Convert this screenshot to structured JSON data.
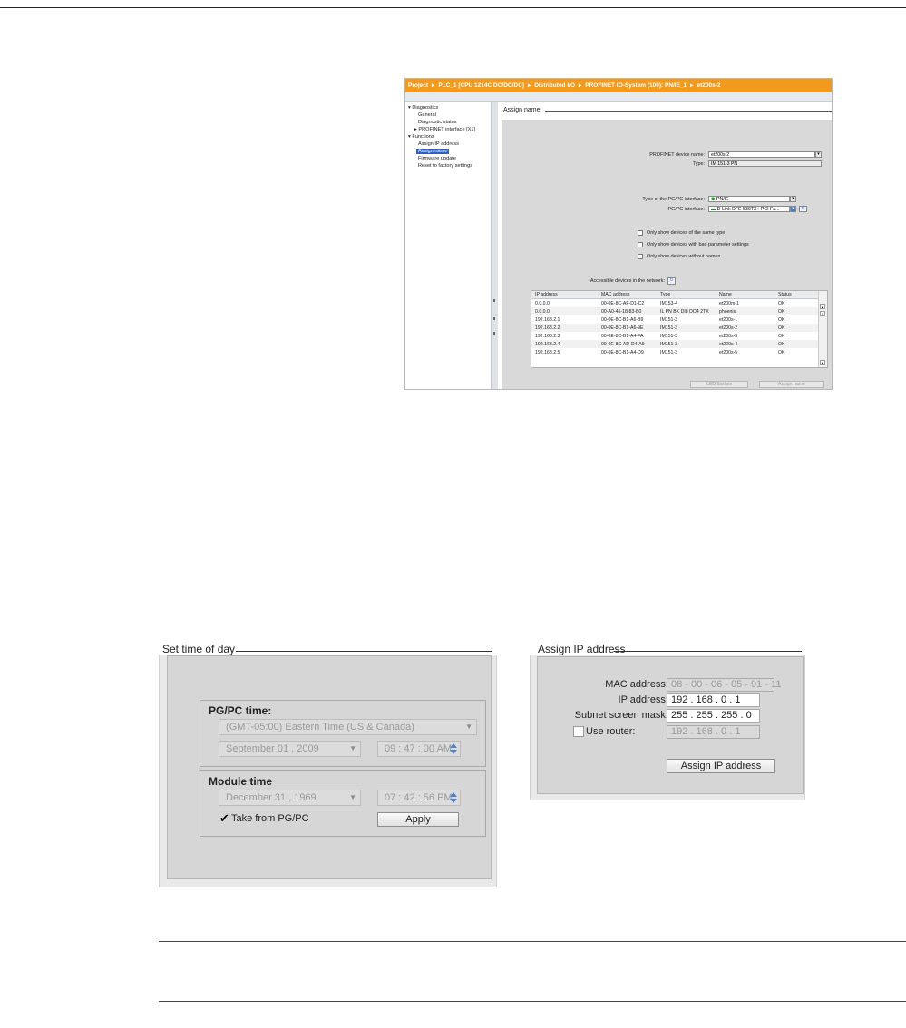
{
  "breadcrumb": [
    "Project",
    "PLC_1 [CPU 1214C DC/DC/DC]",
    "Distributed I/O",
    "PROFINET IO-System (100): PN/IE_1",
    "et200s-2"
  ],
  "tree": {
    "diagnostics": "Diagnostics",
    "general": "General",
    "diagnostic_status": "Diagnostic status",
    "profinet_interface": "PROFINET interface [X1]",
    "functions": "Functions",
    "assign_ip": "Assign IP address",
    "assign_name": "Assign name",
    "firmware_update": "Firmware update",
    "reset_factory": "Reset to factory settings"
  },
  "assign_name": {
    "title": "Assign name",
    "profinet_device_name_label": "PROFINET device name:",
    "profinet_device_name_value": "et200s-2",
    "type_label": "Type:",
    "type_value": "IM 151-3 PN",
    "pgpc_iface_type_label": "Type of the PG/PC interface:",
    "pgpc_iface_type_value": "PN/IE",
    "pgpc_iface_label": "PG/PC interface:",
    "pgpc_iface_value": "D-Link DFE-530TX+ PCI Fa...",
    "filters": [
      "Only show devices of the same type",
      "Only show devices with bad parameter settings",
      "Only show devices without names"
    ],
    "accessible_label": "Accessible devices in the network:",
    "columns": [
      "IP address",
      "MAC address",
      "Type",
      "Name",
      "Status"
    ],
    "rows": [
      [
        "0.0.0.0",
        "00-0E-8C-AF-D1-C2",
        "IM153-4",
        "et200m-1",
        "OK"
      ],
      [
        "0.0.0.0",
        "00-A0-45-18-83-B0",
        "IL PN BK DI8 DO4 2TX",
        "phoenix",
        "OK"
      ],
      [
        "192.168.2.1",
        "00-0E-8C-B1-A6-B9",
        "IM151-3",
        "et200s-1",
        "OK"
      ],
      [
        "192.168.2.2",
        "00-0E-8C-B1-A6-9E",
        "IM151-3",
        "et200s-2",
        "OK"
      ],
      [
        "192.168.2.3",
        "00-0E-8C-B1-A4-FA",
        "IM151-3",
        "et200s-3",
        "OK"
      ],
      [
        "192.168.2.4",
        "00-0E-8C-AD-D4-A9",
        "IM151-3",
        "et200s-4",
        "OK"
      ],
      [
        "192.168.2.5",
        "00-0E-8C-B1-A4-D9",
        "IM151-3",
        "et200s-5",
        "OK"
      ]
    ],
    "led_button": "LED flashes",
    "assign_button": "Assign name"
  },
  "time_of_day": {
    "title": "Set time of day",
    "pgpc_time_title": "PG/PC time:",
    "timezone": "(GMT-05:00) Eastern Time (US & Canada)",
    "pgpc_date": "September  01 ,  2009",
    "pgpc_time": "09 : 47 : 00   AM",
    "module_time_title": "Module time",
    "module_date": "December  31 ,  1969",
    "module_time": "07 : 42 : 56   PM",
    "take_from_label": "Take from PG/PC",
    "apply_button": "Apply"
  },
  "assign_ip": {
    "title": "Assign IP address",
    "mac_label": "MAC address:",
    "mac_value": "08 - 00 - 06 - 05 - 91 - 11",
    "ip_label": "IP address:",
    "ip_value": "192 . 168 . 0    . 1",
    "subnet_label": "Subnet screen mask:",
    "subnet_value": "255 . 255 . 255 . 0",
    "router_label": "Use router:",
    "router_value": "192 . 168 . 0    . 1",
    "assign_button": "Assign IP address"
  }
}
